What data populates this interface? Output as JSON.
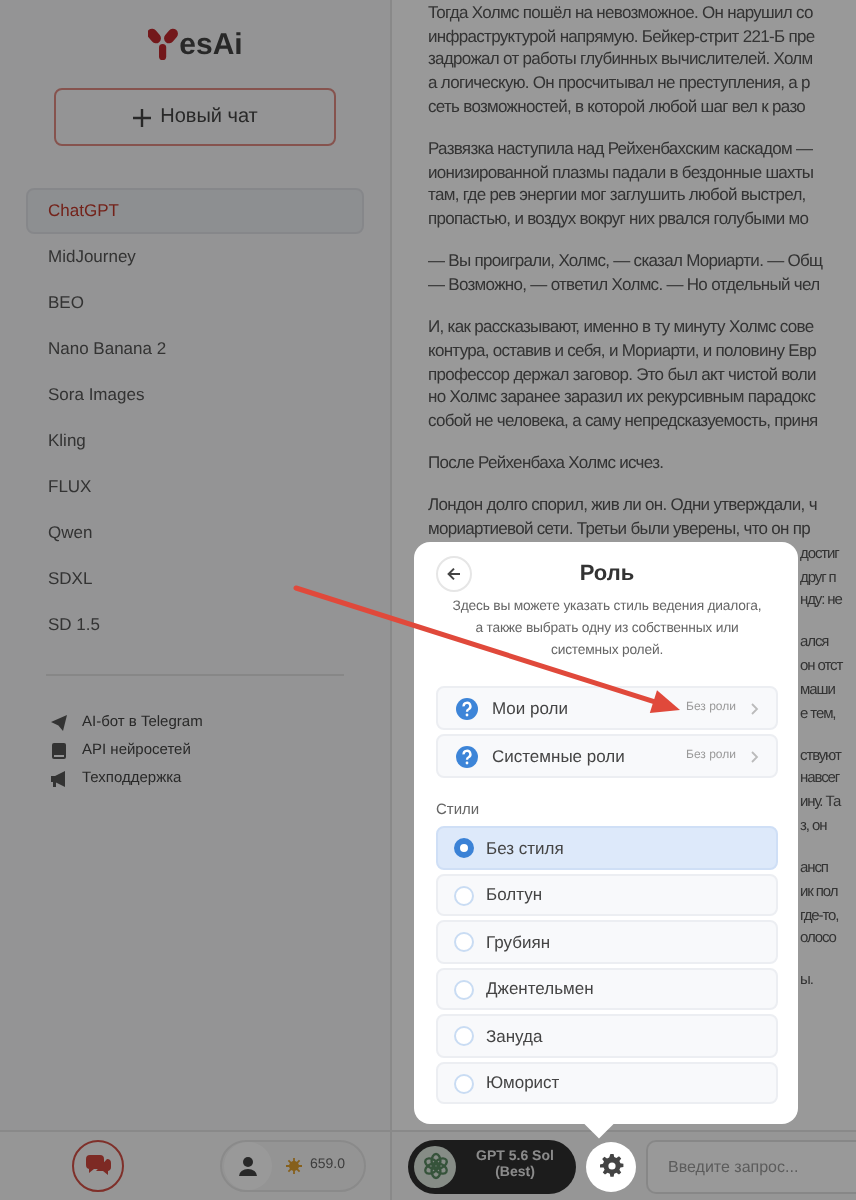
{
  "logo": {
    "text": "esAi"
  },
  "new_chat_button": {
    "label": "Новый чат"
  },
  "models": [
    {
      "label": "ChatGPT",
      "selected": true
    },
    {
      "label": "MidJourney",
      "selected": false
    },
    {
      "label": "BEO",
      "selected": false
    },
    {
      "label": "Nano Banana 2",
      "selected": false
    },
    {
      "label": "Sora Images",
      "selected": false
    },
    {
      "label": "Kling",
      "selected": false
    },
    {
      "label": "FLUX",
      "selected": false
    },
    {
      "label": "Qwen",
      "selected": false
    },
    {
      "label": "SDXL",
      "selected": false
    },
    {
      "label": "SD 1.5",
      "selected": false
    }
  ],
  "links": [
    {
      "label": "AI-бот в Telegram"
    },
    {
      "label": "API нейросетей"
    },
    {
      "label": "Техподдержка"
    }
  ],
  "article": {
    "paragraphs": [
      {
        "lines": [
          {
            "kind": "full",
            "text": "Тогда Холмс пошёл на невозможное. Он нарушил со"
          },
          {
            "kind": "full",
            "text": "инфраструктурой напрямую. Бейкер-стрит 221-Б пре"
          },
          {
            "kind": "full",
            "text": "задрожал от работы глубинных вычислителей. Холм"
          },
          {
            "kind": "full",
            "text": "а логическую. Он просчитывал не преступления, а р"
          },
          {
            "kind": "full",
            "text": "сеть возможностей, в которой любой шаг вел к разо"
          }
        ]
      },
      {
        "lines": [
          {
            "kind": "full",
            "text": "Развязка наступила над Рейхенбахским каскадом —"
          },
          {
            "kind": "full",
            "text": "ионизированной плазмы падали в бездонные шахты"
          },
          {
            "kind": "full",
            "text": "там, где рев энергии мог заглушить любой выстрел,"
          },
          {
            "kind": "full",
            "text": "пропастью, и воздух вокруг них рвался голубыми мо"
          }
        ]
      },
      {
        "lines": [
          {
            "kind": "full",
            "text": "— Вы проиграли, Холмс, — сказал Мориарти. — Общ"
          },
          {
            "kind": "full",
            "text": "— Возможно, — ответил Холмс. — Но отдельный чел"
          }
        ]
      },
      {
        "lines": [
          {
            "kind": "full",
            "text": "И, как рассказывают, именно в ту минуту Холмс сове"
          },
          {
            "kind": "full",
            "text": "контура, оставив и себя, и Мориарти, и половину Евр"
          },
          {
            "kind": "full",
            "text": "профессор держал заговор. Это был акт чистой воли"
          },
          {
            "kind": "full",
            "text": "но Холмс заранее заразил их рекурсивным парадокс"
          },
          {
            "kind": "full",
            "text": "собой не человека, а саму непредсказуемость, приня"
          }
        ]
      },
      {
        "lines": [
          {
            "kind": "full",
            "text": "После Рейхенбаха Холмс исчез."
          }
        ]
      },
      {
        "lines": [
          {
            "kind": "full",
            "text": "Лондон долго спорил, жив ли он. Одни утверждали, ч"
          },
          {
            "kind": "full",
            "text": "мориартиевой сети. Третьи были уверены, что он пр"
          },
          {
            "kind": "edge",
            "text": "достиг"
          },
          {
            "kind": "edge",
            "text": "друг п"
          },
          {
            "kind": "edge",
            "text": "нду: не"
          }
        ]
      },
      {
        "lines": [
          {
            "kind": "edge",
            "text": "ался"
          },
          {
            "kind": "edge",
            "text": "он отст"
          },
          {
            "kind": "edge",
            "text": "маши"
          },
          {
            "kind": "edge",
            "text": "е тем,"
          }
        ]
      },
      {
        "lines": [
          {
            "kind": "edge",
            "text": "ствуют"
          },
          {
            "kind": "edge",
            "text": "навсег"
          },
          {
            "kind": "edge",
            "text": "ину. Та"
          },
          {
            "kind": "edge",
            "text": "з, он"
          }
        ]
      },
      {
        "lines": [
          {
            "kind": "edge",
            "text": "ансп"
          },
          {
            "kind": "edge",
            "text": "ик пол"
          },
          {
            "kind": "edge",
            "text": "где-то,"
          },
          {
            "kind": "edge",
            "text": "олосо"
          }
        ]
      },
      {
        "lines": [
          {
            "kind": "edge",
            "text": "ы."
          }
        ]
      }
    ]
  },
  "popup": {
    "title": "Роль",
    "description": "Здесь вы можете указать стиль ведения диалога, а также выбрать одну из собственных или системных ролей.",
    "roles": [
      {
        "label": "Мои роли",
        "value": "Без роли"
      },
      {
        "label": "Системные роли",
        "value": "Без роли"
      }
    ],
    "styles_label": "Стили",
    "styles": [
      {
        "label": "Без стиля",
        "selected": true
      },
      {
        "label": "Болтун",
        "selected": false
      },
      {
        "label": "Грубиян",
        "selected": false
      },
      {
        "label": "Джентельмен",
        "selected": false
      },
      {
        "label": "Зануда",
        "selected": false
      },
      {
        "label": "Юморист",
        "selected": false
      }
    ]
  },
  "bottom_bar": {
    "balance": "659.0",
    "model": "GPT 5.6 Sol (Best)",
    "input_placeholder": "Введите запрос..."
  }
}
